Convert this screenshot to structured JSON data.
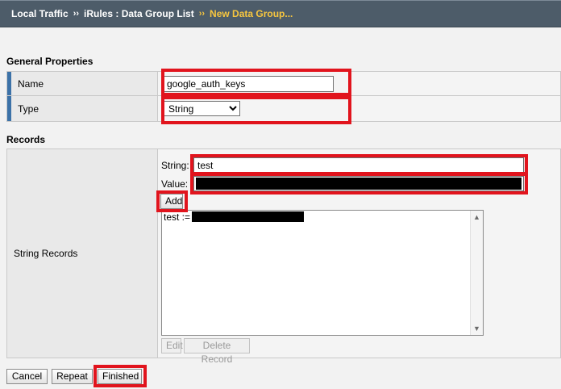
{
  "breadcrumb": {
    "item1": "Local Traffic",
    "item2": "iRules : Data Group List",
    "item3": "New Data Group...",
    "separator": "››"
  },
  "general": {
    "title": "General Properties",
    "name_label": "Name",
    "name_value": "google_auth_keys",
    "type_label": "Type",
    "type_value": "String"
  },
  "records": {
    "title": "Records",
    "label": "String Records",
    "string_label": "String:",
    "string_value": "test",
    "value_label": "Value:",
    "add_label": "Add",
    "entry_prefix": "test :=",
    "edit_label": "Edit",
    "delete_label": "Delete Record"
  },
  "footer": {
    "cancel_label": "Cancel",
    "repeat_label": "Repeat",
    "finished_label": "Finished"
  },
  "colors": {
    "header_bg": "#4d5c69",
    "current_crumb": "#f7c63f",
    "highlight": "#e1141d",
    "label_accent": "#3c72a8"
  },
  "icons": {
    "scroll_up": "scroll-up-arrow-icon",
    "scroll_down": "scroll-down-arrow-icon",
    "select_arrow": "chevron-down-icon"
  }
}
